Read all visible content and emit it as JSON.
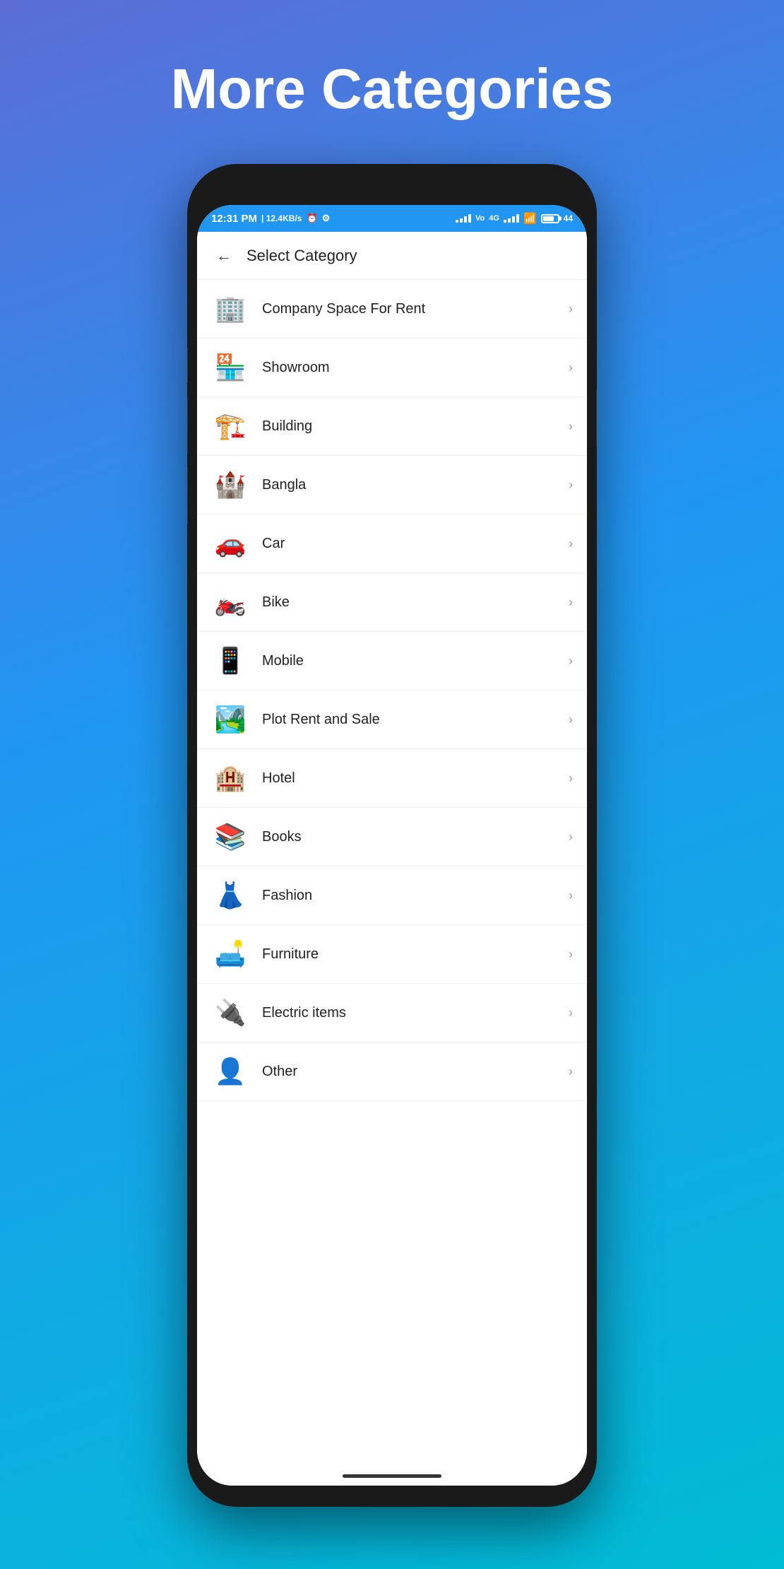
{
  "page": {
    "title": "More Categories",
    "background_gradient": "linear-gradient(160deg, #5b6dd6 0%, #2196f3 40%, #00bcd4 100%)"
  },
  "status_bar": {
    "time": "12:31 PM",
    "data_speed": "12.4KB/s",
    "battery": "44"
  },
  "app_bar": {
    "back_label": "←",
    "title": "Select Category"
  },
  "categories": [
    {
      "id": "company-space",
      "label": "Company Space For Rent",
      "icon": "🏢",
      "chevron": "›"
    },
    {
      "id": "showroom",
      "label": "Showroom",
      "icon": "🏪",
      "chevron": "›"
    },
    {
      "id": "building",
      "label": "Building",
      "icon": "🏗️",
      "chevron": "›"
    },
    {
      "id": "bangla",
      "label": "Bangla",
      "icon": "🏰",
      "chevron": "›"
    },
    {
      "id": "car",
      "label": "Car",
      "icon": "🚗",
      "chevron": "›"
    },
    {
      "id": "bike",
      "label": "Bike",
      "icon": "🏍️",
      "chevron": "›"
    },
    {
      "id": "mobile",
      "label": "Mobile",
      "icon": "📱",
      "chevron": "›"
    },
    {
      "id": "plot-rent-sale",
      "label": "Plot Rent and Sale",
      "icon": "🏞️",
      "chevron": "›"
    },
    {
      "id": "hotel",
      "label": "Hotel",
      "icon": "🏨",
      "chevron": "›"
    },
    {
      "id": "books",
      "label": "Books",
      "icon": "📚",
      "chevron": "›"
    },
    {
      "id": "fashion",
      "label": "Fashion",
      "icon": "👗",
      "chevron": "›"
    },
    {
      "id": "furniture",
      "label": "Furniture",
      "icon": "🛋️",
      "chevron": "›"
    },
    {
      "id": "electric-items",
      "label": "Electric items",
      "icon": "🔌",
      "chevron": "›"
    },
    {
      "id": "other",
      "label": "Other",
      "icon": "👤",
      "chevron": "›"
    }
  ]
}
